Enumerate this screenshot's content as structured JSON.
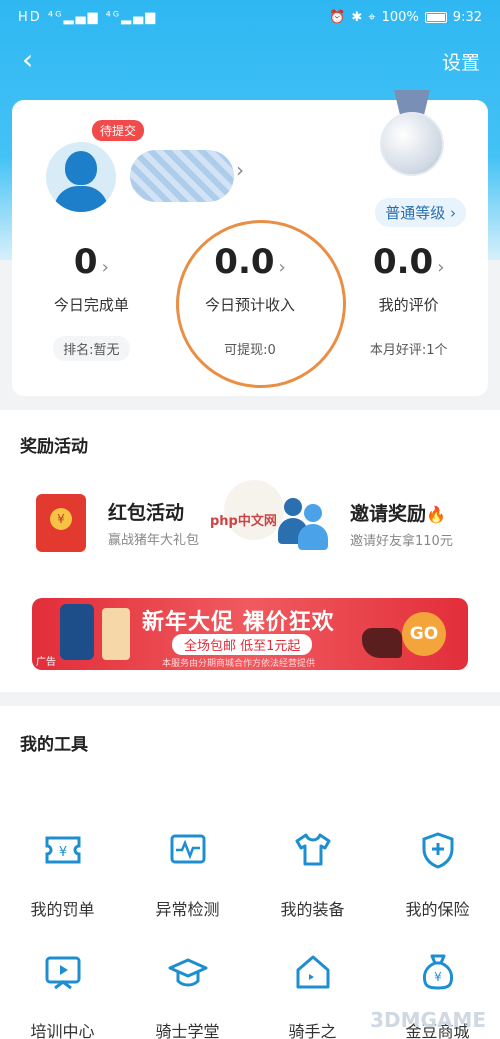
{
  "status_bar": {
    "left": "HD ⁴ᴳ▂▄▆ ⁴ᴳ▂▄▆",
    "battery": "100%",
    "time": "9:32"
  },
  "nav": {
    "back_icon": "chevron-left-icon",
    "settings_label": "设置"
  },
  "profile": {
    "status_badge": "待提交",
    "level_label": "普通等级 ›"
  },
  "stats": [
    {
      "value": "0",
      "label": "今日完成单",
      "sub": "排名:暂无"
    },
    {
      "value": "0.0",
      "label": "今日预计收入",
      "sub": "可提现:0"
    },
    {
      "value": "0.0",
      "label": "我的评价",
      "sub": "本月好评:1个"
    }
  ],
  "rewards": {
    "title": "奖励活动",
    "items": [
      {
        "title": "红包活动",
        "subtitle": "赢战猪年大礼包"
      },
      {
        "title": "邀请奖励",
        "subtitle": "邀请好友拿110元"
      }
    ],
    "banner": {
      "title": "新年大促 裸价狂欢",
      "subtitle": "全场包邮 低至1元起",
      "fine_print": "本服务由分期商城合作方依法经营提供",
      "go": "GO",
      "ad": "广告"
    }
  },
  "tools": {
    "title": "我的工具",
    "items": [
      {
        "label": "我的罚单",
        "icon": "ticket-yen-icon"
      },
      {
        "label": "异常检测",
        "icon": "pulse-monitor-icon"
      },
      {
        "label": "我的装备",
        "icon": "shirt-icon"
      },
      {
        "label": "我的保险",
        "icon": "shield-plus-icon"
      },
      {
        "label": "培训中心",
        "icon": "screen-play-icon"
      },
      {
        "label": "骑士学堂",
        "icon": "graduation-cap-icon"
      },
      {
        "label": "骑手之",
        "icon": "home-icon"
      },
      {
        "label": "金豆商城",
        "icon": "money-bag-icon"
      }
    ]
  },
  "watermarks": {
    "php": "php中文网",
    "site": "3DMGAME"
  },
  "colors": {
    "header_blue": "#2fb7f2",
    "accent_red": "#e22e3a",
    "icon_blue": "#1d7fc9"
  }
}
